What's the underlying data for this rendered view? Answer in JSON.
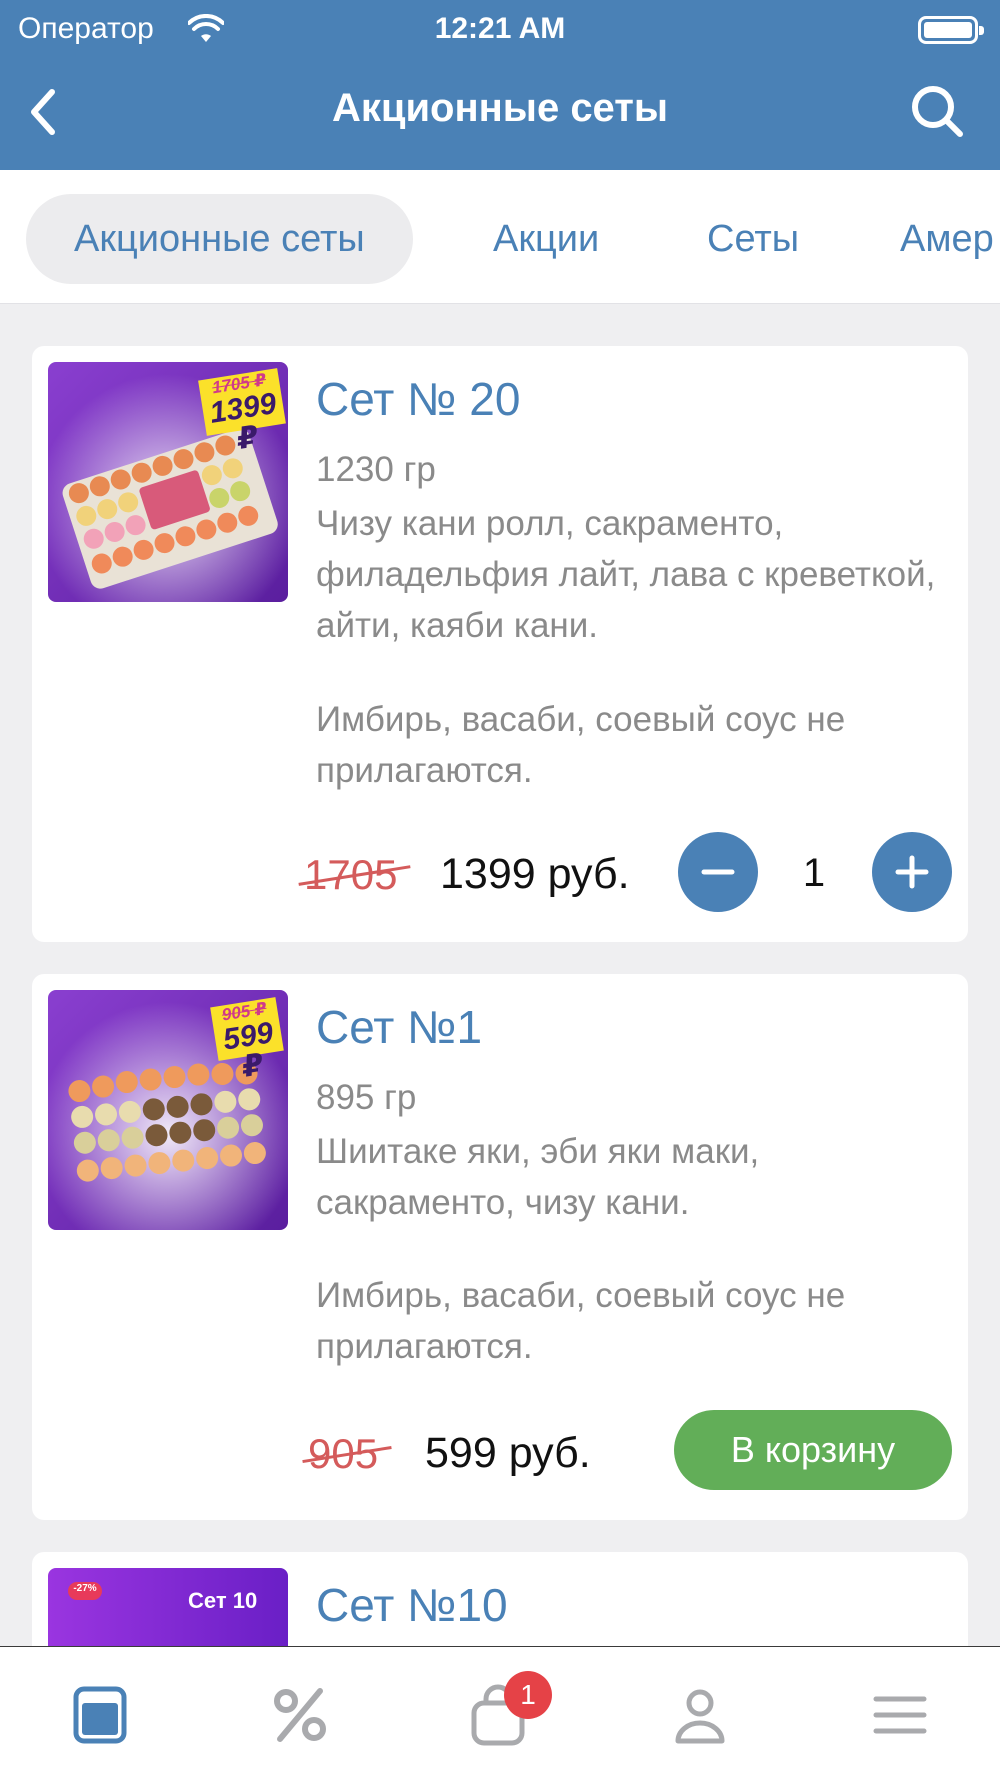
{
  "status_bar": {
    "carrier": "Оператор",
    "time": "12:21 AM"
  },
  "header": {
    "title": "Акционные сеты",
    "back_icon": "chevron-left-icon",
    "search_icon": "search-icon"
  },
  "tabs": [
    {
      "label": "Акционные сеты",
      "active": true
    },
    {
      "label": "Акции",
      "active": false
    },
    {
      "label": "Сеты",
      "active": false
    },
    {
      "label": "Амер",
      "active": false
    }
  ],
  "products": [
    {
      "title": "Сет № 20",
      "weight": "1230 гр",
      "description": "Чизу кани ролл, сакраменто, филадельфия лайт, лава с креветкой, айти, каяби кани.",
      "note": "Имбирь, васаби, соевый соус не прилагаются.",
      "old_price": "1705",
      "price": "1399 руб.",
      "quantity": "1",
      "badge_old": "1705 ₽",
      "badge_new": "1399 ₽"
    },
    {
      "title": "Сет №1",
      "weight": "895 гр",
      "description": "Шиитаке яки, эби яки маки, сакраменто, чизу кани.",
      "note": "Имбирь, васаби, соевый соус не прилагаются.",
      "old_price": "905",
      "price": "599 руб.",
      "cart_label": "В корзину",
      "badge_old": "905 ₽",
      "badge_new": "599 ₽"
    },
    {
      "title": "Сет №10",
      "badge_discount": "-27%",
      "badge_label": "Сет 10"
    }
  ],
  "bottom_nav": {
    "items": [
      "menu-book-icon",
      "percent-icon",
      "cart-icon",
      "profile-icon",
      "hamburger-icon"
    ],
    "cart_count": "1"
  },
  "colors": {
    "primary": "#4a81b6",
    "green": "#62ae58",
    "old_price": "#d45b5b",
    "badge": "#e54247"
  }
}
